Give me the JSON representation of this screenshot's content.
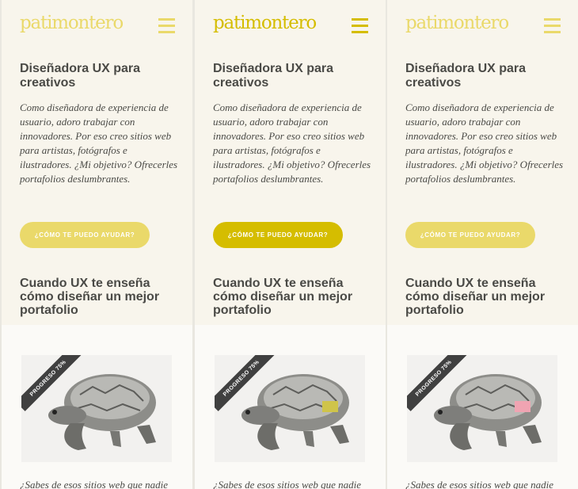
{
  "colors": {
    "brand_light": "#ead96a",
    "brand_dark": "#d5bd00",
    "text": "#4a4a46",
    "ribbon": "#404040",
    "shell_yellow": "#cfc44a",
    "shell_pink": "#f0a4b2"
  },
  "panels": [
    {
      "logo": "patimontero",
      "menu_icon": "hamburger-icon",
      "headline": "Diseñadora UX para creativos",
      "intro": "Como diseñadora de experiencia de usuario, adoro trabajar con innovadores. Por eso creo sitios web para artistas, fotógrafos e ilustradores. ¿Mi objetivo? Ofrecerles portafolios deslumbrantes.",
      "cta": "¿CÓMO TE PUEDO AYUDAR?",
      "section_title": "Cuando UX te enseña cómo diseñar un mejor portafolio",
      "ribbon": "PROGRESO 75%",
      "teaser": "¿Sabes de esos sitios web que nadie",
      "theme": "light"
    },
    {
      "logo": "patimontero",
      "menu_icon": "hamburger-icon",
      "headline": "Diseñadora UX para creativos",
      "intro": "Como diseñadora de experiencia de usuario, adoro trabajar con innovadores. Por eso creo sitios web para artistas, fotógrafos e ilustradores. ¿Mi objetivo? Ofrecerles portafolios deslumbrantes.",
      "cta": "¿CÓMO TE PUEDO AYUDAR?",
      "section_title": "Cuando UX te enseña cómo diseñar un mejor portafolio",
      "ribbon": "PROGRESO 75%",
      "teaser": "¿Sabes de esos sitios web que nadie",
      "theme": "dark"
    },
    {
      "logo": "patimontero",
      "menu_icon": "hamburger-icon",
      "headline": "Diseñadora UX para creativos",
      "intro": "Como diseñadora de experiencia de usuario, adoro trabajar con innovadores. Por eso creo sitios web para artistas, fotógrafos e ilustradores. ¿Mi objetivo? Ofrecerles portafolios deslumbrantes.",
      "cta": "¿CÓMO TE PUEDO AYUDAR?",
      "section_title": "Cuando UX te enseña cómo diseñar un mejor portafolio",
      "ribbon": "PROGRESO 75%",
      "teaser": "¿Sabes de esos sitios web que nadie",
      "theme": "pink"
    }
  ]
}
